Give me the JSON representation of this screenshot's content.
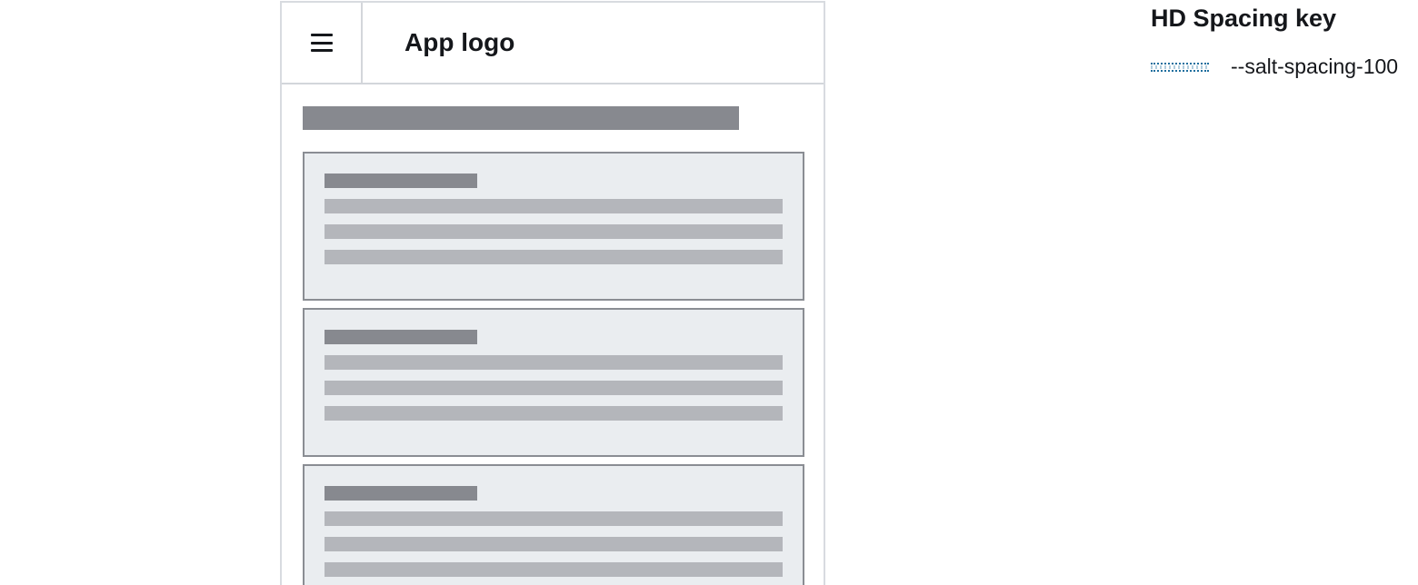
{
  "header": {
    "logo_text": "App logo",
    "menu_icon": "hamburger-icon"
  },
  "content": {
    "cards": [
      {
        "line_count": 3
      },
      {
        "line_count": 3
      },
      {
        "line_count": 3
      }
    ]
  },
  "spacing_key": {
    "title": "HD Spacing key",
    "items": [
      {
        "label": "--salt-spacing-100",
        "color": "#1f6f9e"
      }
    ]
  },
  "colors": {
    "placeholder_dark": "#87898f",
    "placeholder_light": "#b4b6bb",
    "card_background": "#eaedf0",
    "border": "#d8dbe0"
  }
}
